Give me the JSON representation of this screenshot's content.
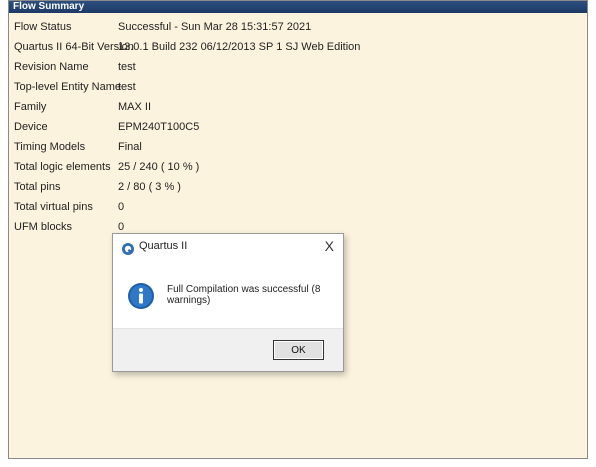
{
  "window": {
    "title": "Flow Summary"
  },
  "summary": [
    {
      "label": "Flow Status",
      "value": "Successful - Sun Mar 28 15:31:57 2021"
    },
    {
      "label": "Quartus II 64-Bit Version",
      "value": "13.0.1 Build 232 06/12/2013 SP 1 SJ Web Edition"
    },
    {
      "label": "Revision Name",
      "value": "test"
    },
    {
      "label": "Top-level Entity Name",
      "value": "test"
    },
    {
      "label": "Family",
      "value": "MAX II"
    },
    {
      "label": "Device",
      "value": "EPM240T100C5"
    },
    {
      "label": "Timing Models",
      "value": "Final"
    },
    {
      "label": "Total logic elements",
      "value": "25 / 240 ( 10 % )"
    },
    {
      "label": "Total pins",
      "value": "2 / 80 ( 3 % )"
    },
    {
      "label": "Total virtual pins",
      "value": "0"
    },
    {
      "label": "UFM blocks",
      "value": "0"
    }
  ],
  "dialog": {
    "title": "Quartus II",
    "close_label": "X",
    "message": "Full Compilation was successful (8 warnings)",
    "ok_label": "OK",
    "app_icon": "quartus-icon",
    "message_icon": "info-icon"
  },
  "colors": {
    "title_bar": "#1c3a66",
    "background": "#fcf3df",
    "info_blue": "#1f5fa8"
  }
}
